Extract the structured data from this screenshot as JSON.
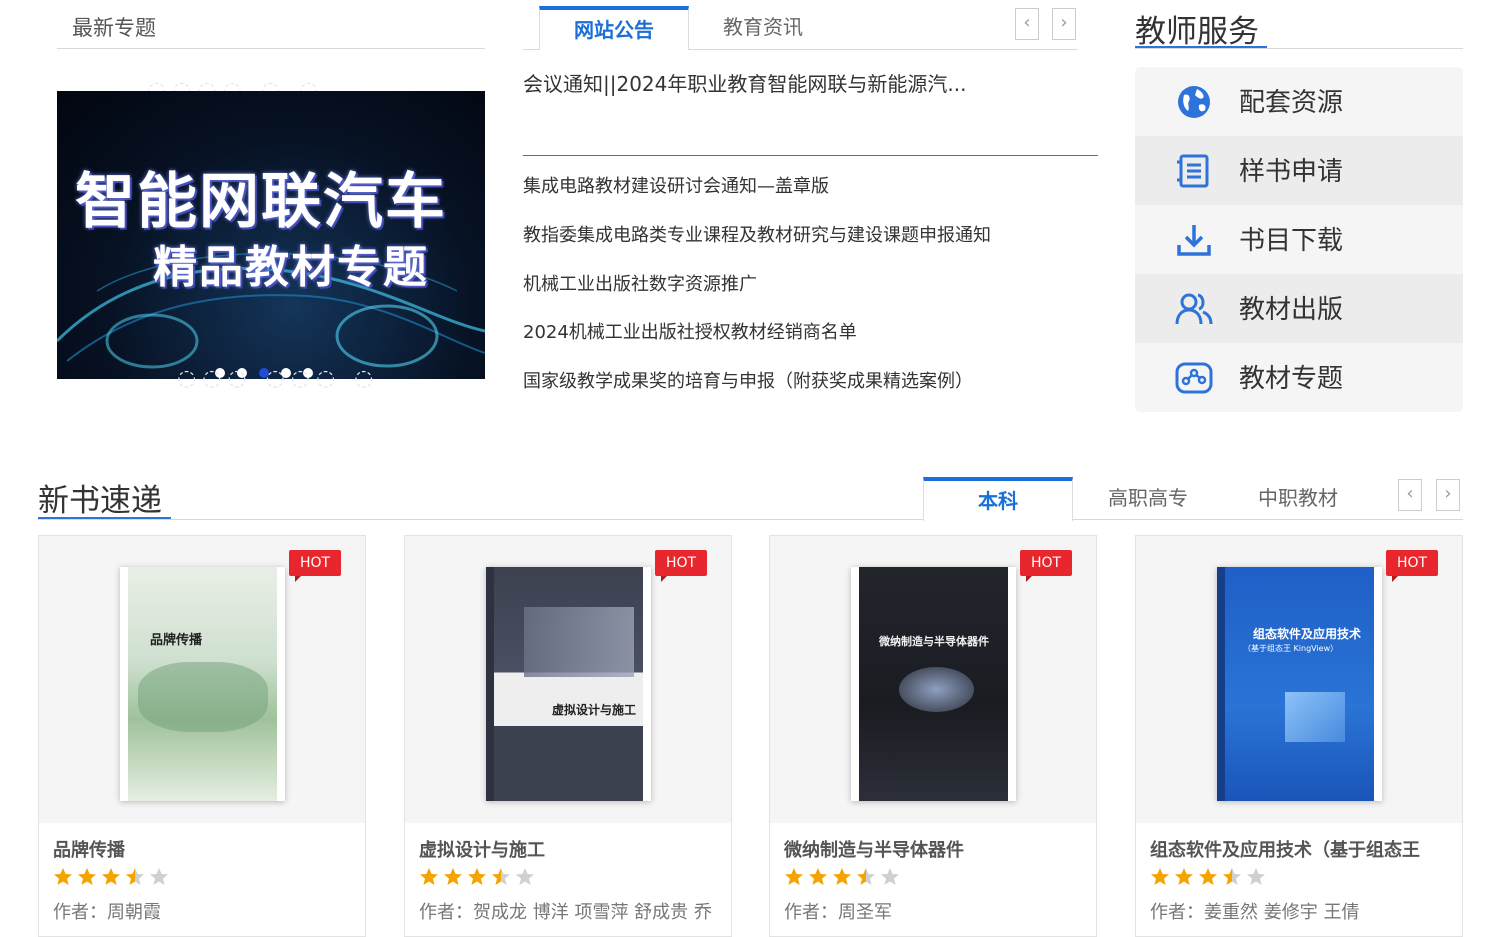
{
  "topics": {
    "title": "最新专题",
    "banner": {
      "line1": "智能网联汽车",
      "line2": "精品教材专题"
    },
    "slide_count": 5,
    "active_slide": 3
  },
  "notices": {
    "tabs": [
      "网站公告",
      "教育资讯"
    ],
    "active_tab": "网站公告",
    "featured": "会议通知||2024年职业教育智能网联与新能源汽...",
    "items": [
      "集成电路教材建设研讨会通知—盖章版",
      "教指委集成电路类专业课程及教材研究与建设课题申报通知",
      "机械工业出版社数字资源推广",
      "2024机械工业出版社授权教材经销商名单",
      "国家级教学成果奖的培育与申报（附获奖成果精选案例）"
    ],
    "prev_arrow": "‹",
    "next_arrow": "›"
  },
  "services": {
    "title": "教师服务",
    "items": [
      {
        "label": "配套资源",
        "icon": "globe-icon"
      },
      {
        "label": "样书申请",
        "icon": "document-list-icon"
      },
      {
        "label": "书目下载",
        "icon": "download-icon"
      },
      {
        "label": "教材出版",
        "icon": "users-icon"
      },
      {
        "label": "教材专题",
        "icon": "topic-icon"
      }
    ],
    "accent": "#2e73d9"
  },
  "newbooks": {
    "title": "新书速递",
    "tabs": [
      "本科",
      "高职高专",
      "中职教材"
    ],
    "active_tab": "本科",
    "prev_arrow": "‹",
    "next_arrow": "›",
    "hot_label": "HOT",
    "books": [
      {
        "name": "品牌传播",
        "author": "作者：周朝霞",
        "rating": 3.5,
        "cover_title": "品牌传播"
      },
      {
        "name": "虚拟设计与施工",
        "author": "作者：贺成龙 博洋 项雪萍 舒成贵 乔",
        "rating": 3.5,
        "cover_title": "虚拟设计与施工"
      },
      {
        "name": "微纳制造与半导体器件",
        "author": "作者：周圣军",
        "rating": 3.5,
        "cover_title": "微纳制造与半导体器件"
      },
      {
        "name": "组态软件及应用技术（基于组态王",
        "author": "作者：姜重然 姜修宇 王倩",
        "rating": 3.5,
        "cover_title": "组态软件及应用技术",
        "cover_subtitle": "（基于组态王 KingView）"
      }
    ]
  }
}
